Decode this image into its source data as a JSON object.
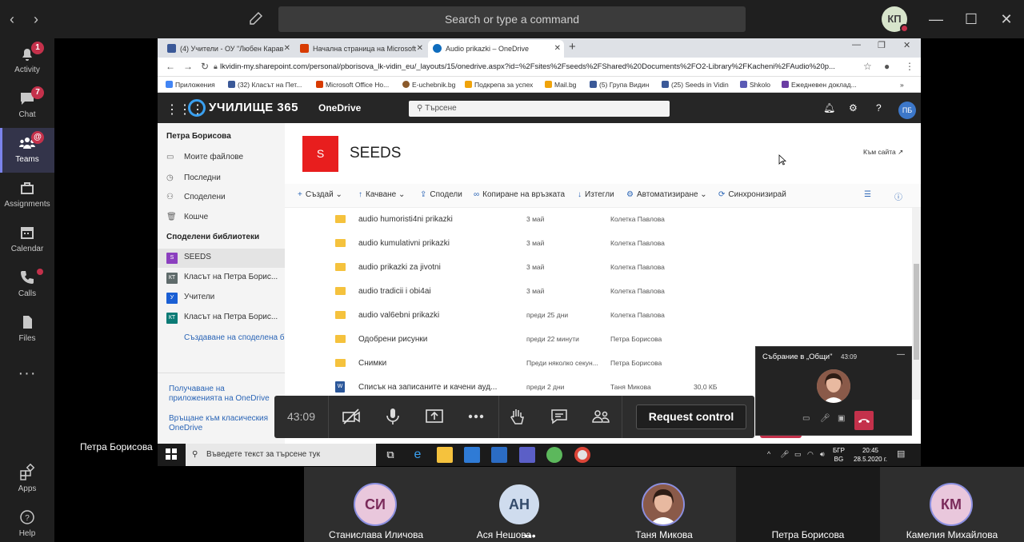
{
  "teams": {
    "search_placeholder": "Search or type a command",
    "avatar_initials": "КП",
    "rail": [
      {
        "label": "Activity",
        "badge": "1"
      },
      {
        "label": "Chat",
        "badge": "7"
      },
      {
        "label": "Teams",
        "badge": "@"
      },
      {
        "label": "Assignments"
      },
      {
        "label": "Calendar"
      },
      {
        "label": "Calls"
      },
      {
        "label": "Files"
      },
      {
        "label": "Apps"
      },
      {
        "label": "Help"
      }
    ],
    "more": "···"
  },
  "browser": {
    "tabs": [
      {
        "label": "(4) Учители - ОУ \"Любен Карав",
        "fav_color": "#3b5998"
      },
      {
        "label": "Начална страница на Microsoft",
        "fav_color": "#d83b01"
      },
      {
        "label": "Audio prikazki – OneDrive",
        "fav_color": "#0f6cbd"
      }
    ],
    "url": "lkvidin-my.sharepoint.com/personal/pborisova_lk-vidin_eu/_layouts/15/onedrive.aspx?id=%2Fsites%2Fseeds%2FShared%20Documents%2FO2-Library%2FKacheni%2FAudio%20p...",
    "bookmarks": [
      {
        "label": "Приложения",
        "color": "#4285f4"
      },
      {
        "label": "(32) Класът на Пет...",
        "color": "#3b5998"
      },
      {
        "label": "Microsoft Office Ho...",
        "color": "#d83b01"
      },
      {
        "label": "E-uchebnik.bg",
        "color": "#8b5a2b"
      },
      {
        "label": "Подкрепа за успех",
        "color": "#f0a30a"
      },
      {
        "label": "Mail.bg",
        "color": "#f0a30a"
      },
      {
        "label": "(5) Група Видин",
        "color": "#3b5998"
      },
      {
        "label": "(25) Seeds in Vidin",
        "color": "#3b5998"
      },
      {
        "label": "Shkolo",
        "color": "#5a5ab5"
      },
      {
        "label": "Ежедневен доклад...",
        "color": "#6a3da3"
      }
    ]
  },
  "onedrive": {
    "brand": "УЧИЛИЩЕ 365",
    "app": "OneDrive",
    "search_placeholder": "Търсене",
    "user_initials": "ПБ",
    "left": {
      "user": "Петра Борисова",
      "nav": [
        "Моите файлове",
        "Последни",
        "Споделени",
        "Кошче"
      ],
      "shared_header": "Споделени библиотеки",
      "libraries": [
        {
          "label": "SEEDS",
          "color": "#8b3fbf"
        },
        {
          "label": "Класът на Петра Борис...",
          "color": "#5f6b6b"
        },
        {
          "label": "Учители",
          "color": "#1a5fd4"
        },
        {
          "label": "Класът на Петра Борис...",
          "color": "#0b7a75"
        }
      ],
      "create_link": "Създаване на споделена би",
      "footer_links": [
        "Получаване на приложенията на OneDrive",
        "Връщане към класическия OneDrive"
      ]
    },
    "site": {
      "logo_letter": "S",
      "title": "SEEDS",
      "link": "Към сайта ↗"
    },
    "commands": [
      {
        "icon": "+",
        "label": "Създай"
      },
      {
        "icon": "↑",
        "label": "Качване"
      },
      {
        "icon": "⇪",
        "label": "Сподели"
      },
      {
        "icon": "∞",
        "label": "Копиране на връзката"
      },
      {
        "icon": "↓",
        "label": "Изтегли"
      },
      {
        "icon": "⚙",
        "label": "Автоматизиране"
      },
      {
        "icon": "⟳",
        "label": "Синхронизирай"
      }
    ],
    "rows": [
      {
        "type": "folder",
        "name": "audio humoristi4ni prikazki",
        "date": "3 май",
        "person": "Колетка Павлова",
        "size": ""
      },
      {
        "type": "folder",
        "name": "audio kumulativni prikazki",
        "date": "3 май",
        "person": "Колетка Павлова",
        "size": ""
      },
      {
        "type": "folder",
        "name": "audio prikazki za jivotni",
        "date": "3 май",
        "person": "Колетка Павлова",
        "size": ""
      },
      {
        "type": "folder",
        "name": "audio tradicii i obi4ai",
        "date": "3 май",
        "person": "Колетка Павлова",
        "size": ""
      },
      {
        "type": "folder",
        "name": "audio val6ebni prikazki",
        "date": "преди 25 дни",
        "person": "Колетка Павлова",
        "size": ""
      },
      {
        "type": "folder",
        "name": "Одобрени рисунки",
        "date": "преди 22 минути",
        "person": "Петра Борисова",
        "size": ""
      },
      {
        "type": "folder",
        "name": "Снимки",
        "date": "Преди няколко секун...",
        "person": "Петра Борисова",
        "size": ""
      },
      {
        "type": "doc",
        "name": "Списък на записаните и качени ауд...",
        "date": "преди 2 дни",
        "person": "Таня Микова",
        "size": "30,0 КБ"
      }
    ]
  },
  "windows": {
    "search_placeholder": "Въведете текст за търсене тук",
    "lang": [
      "БГР",
      "BG"
    ],
    "time": "20:45",
    "date": "28.5.2020 г."
  },
  "call": {
    "duration": "43:09",
    "request_control": "Request control",
    "mini_title": "Събрание в „Общи\"",
    "mini_time": "43:09",
    "presenter": "Петра Борисова"
  },
  "participants": [
    {
      "initials": "СИ",
      "name": "Станислава Иличова",
      "bg": "#e9c7dc",
      "fg": "#7a2a5a"
    },
    {
      "initials": "АН",
      "name": "Ася Нешова",
      "bg": "#cfdcee",
      "fg": "#344b6b"
    },
    {
      "initials": "",
      "name": "Таня Микова",
      "bg": "#a8705f",
      "fg": "#fff"
    },
    {
      "initials": "",
      "name": "Петра Борисова",
      "bg": "",
      "fg": ""
    },
    {
      "initials": "КМ",
      "name": "Камелия Михайлова",
      "bg": "#e9c7dc",
      "fg": "#7a2a5a"
    }
  ],
  "colors": {
    "teams_accent": "#7b83eb",
    "hangup": "#c4314b",
    "onedrive_link": "#2b65b6",
    "site_logo": "#e81e1e"
  }
}
